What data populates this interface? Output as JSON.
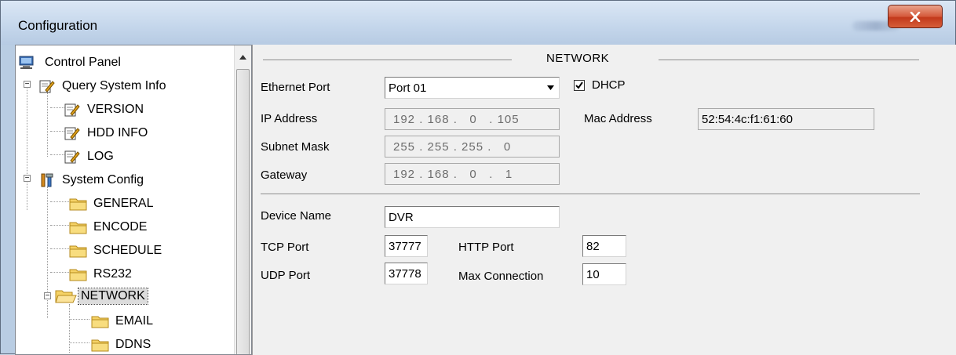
{
  "window": {
    "title": "Configuration",
    "close_label": "X"
  },
  "tree": {
    "items": [
      {
        "label": "Control Panel"
      },
      {
        "label": "Query System Info"
      },
      {
        "label": "VERSION"
      },
      {
        "label": "HDD INFO"
      },
      {
        "label": "LOG"
      },
      {
        "label": "System Config"
      },
      {
        "label": "GENERAL"
      },
      {
        "label": "ENCODE"
      },
      {
        "label": "SCHEDULE"
      },
      {
        "label": "RS232"
      },
      {
        "label": "NETWORK"
      },
      {
        "label": "EMAIL"
      },
      {
        "label": "DDNS"
      }
    ],
    "selected": "NETWORK"
  },
  "network": {
    "section_title": "NETWORK",
    "ethernet_port": {
      "label": "Ethernet Port",
      "value": "Port 01"
    },
    "dhcp": {
      "label": "DHCP",
      "checked": true
    },
    "ip_address": {
      "label": "IP Address",
      "value": "192 . 168 .   0   . 105"
    },
    "mac_address": {
      "label": "Mac Address",
      "value": "52:54:4c:f1:61:60"
    },
    "subnet_mask": {
      "label": "Subnet Mask",
      "value": "255 . 255 . 255 .   0"
    },
    "gateway": {
      "label": "Gateway",
      "value": "192 . 168 .   0   .   1"
    },
    "device_name": {
      "label": "Device Name",
      "value": "DVR"
    },
    "tcp_port": {
      "label": "TCP Port",
      "value": "37777"
    },
    "http_port": {
      "label": "HTTP Port",
      "value": "82"
    },
    "udp_port": {
      "label": "UDP Port",
      "value": "37778"
    },
    "max_connection": {
      "label": "Max Connection",
      "value": "10"
    }
  }
}
